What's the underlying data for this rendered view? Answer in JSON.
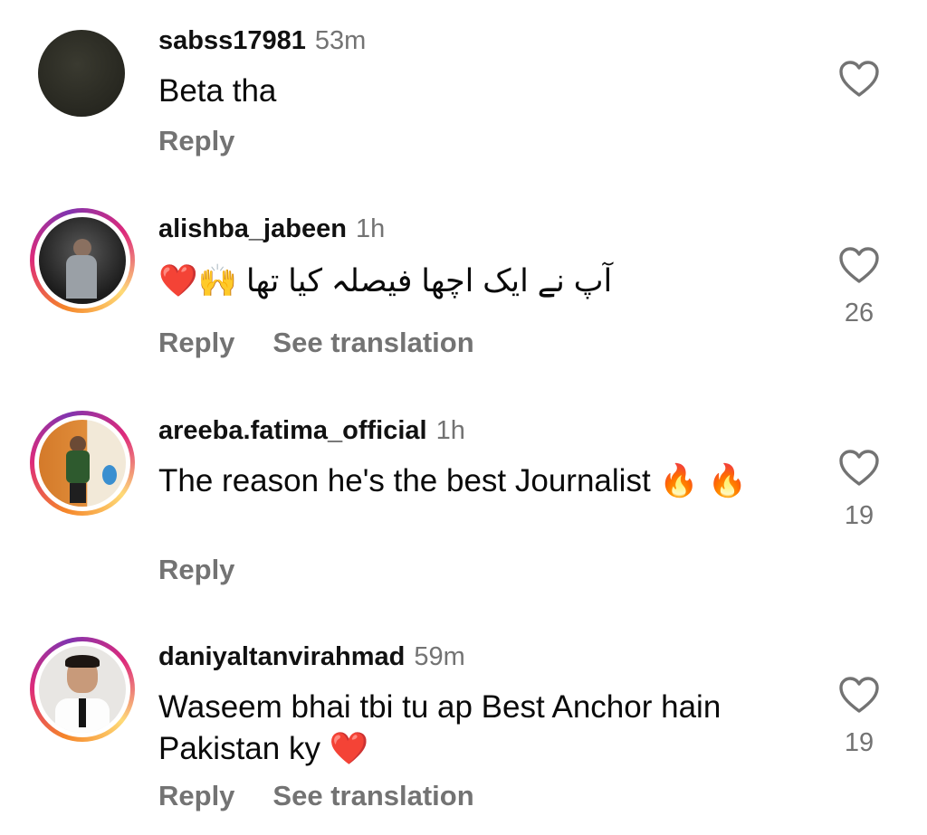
{
  "comments": [
    {
      "username": "sabss17981",
      "time": "53m",
      "text": "Beta tha",
      "reply_label": "Reply",
      "translation_label": "",
      "likes": ""
    },
    {
      "username": "alishba_jabeen",
      "time": "1h",
      "text": "آپ نے ایک اچھا فیصلہ کیا تھا 🙌❤️",
      "reply_label": "Reply",
      "translation_label": "See translation",
      "likes": "26"
    },
    {
      "username": "areeba.fatima_official",
      "time": "1h",
      "text": "The reason he's the best Journalist 🔥 🔥",
      "reply_label": "Reply",
      "translation_label": "",
      "likes": "19"
    },
    {
      "username": "daniyaltanvirahmad",
      "time": "59m",
      "text": "Waseem bhai tbi tu ap Best Anchor hain Pakistan ky ❤️",
      "reply_label": "Reply",
      "translation_label": "See translation",
      "likes": "19"
    }
  ],
  "colors": {
    "text": "#0c0c0c",
    "secondary": "#737373",
    "story_ring_start": "#f58529",
    "story_ring_mid": "#dd2a7b",
    "story_ring_end": "#8134af"
  },
  "icons": [
    "heart-outline-icon"
  ]
}
